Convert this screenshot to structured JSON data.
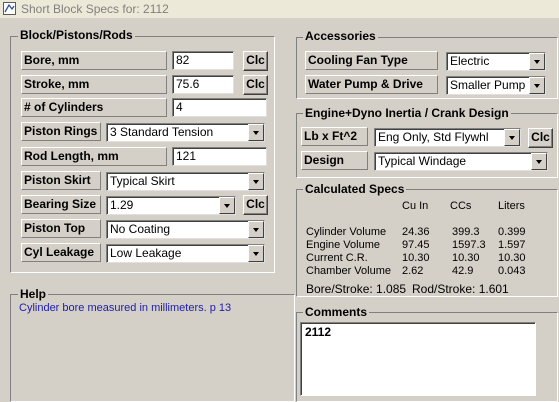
{
  "window": {
    "title": "Short Block Specs for: 2112"
  },
  "block": {
    "title": "Block/Pistons/Rods",
    "bore_label": "Bore, mm",
    "bore_value": "82",
    "stroke_label": "Stroke, mm",
    "stroke_value": "75.6",
    "cylinders_label": "# of Cylinders",
    "cylinders_value": "4",
    "rings_label": "Piston Rings",
    "rings_value": "3 Standard Tension",
    "rod_label": "Rod Length, mm",
    "rod_value": "121",
    "skirt_label": "Piston Skirt",
    "skirt_value": "Typical Skirt",
    "bearing_label": "Bearing Size",
    "bearing_value": "1.29",
    "top_label": "Piston Top",
    "top_value": "No Coating",
    "leakage_label": "Cyl Leakage",
    "leakage_value": "Low Leakage",
    "clc_label": "Clc"
  },
  "help": {
    "title": "Help",
    "text": "Cylinder bore measured in millimeters.  p 13"
  },
  "accessories": {
    "title": "Accessories",
    "fan_label": "Cooling Fan Type",
    "fan_value": "Electric",
    "pump_label": "Water Pump & Drive",
    "pump_value": "Smaller Pump"
  },
  "inertia": {
    "title": "Engine+Dyno Inertia / Crank Design",
    "lbft_label": "Lb x Ft^2",
    "lbft_value": "Eng Only, Std Flywhl",
    "design_label": "Design",
    "design_value": "Typical Windage",
    "clc_label": "Clc"
  },
  "calc": {
    "title": "Calculated Specs",
    "headers": [
      "Cu In",
      "CCs",
      "Liters"
    ],
    "rows": [
      {
        "label": "Cylinder Volume",
        "cuin": "24.36",
        "cc": "399.3",
        "liters": "0.399"
      },
      {
        "label": "Engine Volume",
        "cuin": "97.45",
        "cc": "1597.3",
        "liters": "1.597"
      },
      {
        "label": "Current C.R.",
        "cuin": "10.30",
        "cc": "10.30",
        "liters": "10.30"
      },
      {
        "label": "Chamber Volume",
        "cuin": "2.62",
        "cc": "42.9",
        "liters": "0.043"
      }
    ],
    "bore_stroke": "Bore/Stroke: 1.085",
    "rod_stroke": "Rod/Stroke: 1.601"
  },
  "comments": {
    "title": "Comments",
    "value": "2112"
  }
}
